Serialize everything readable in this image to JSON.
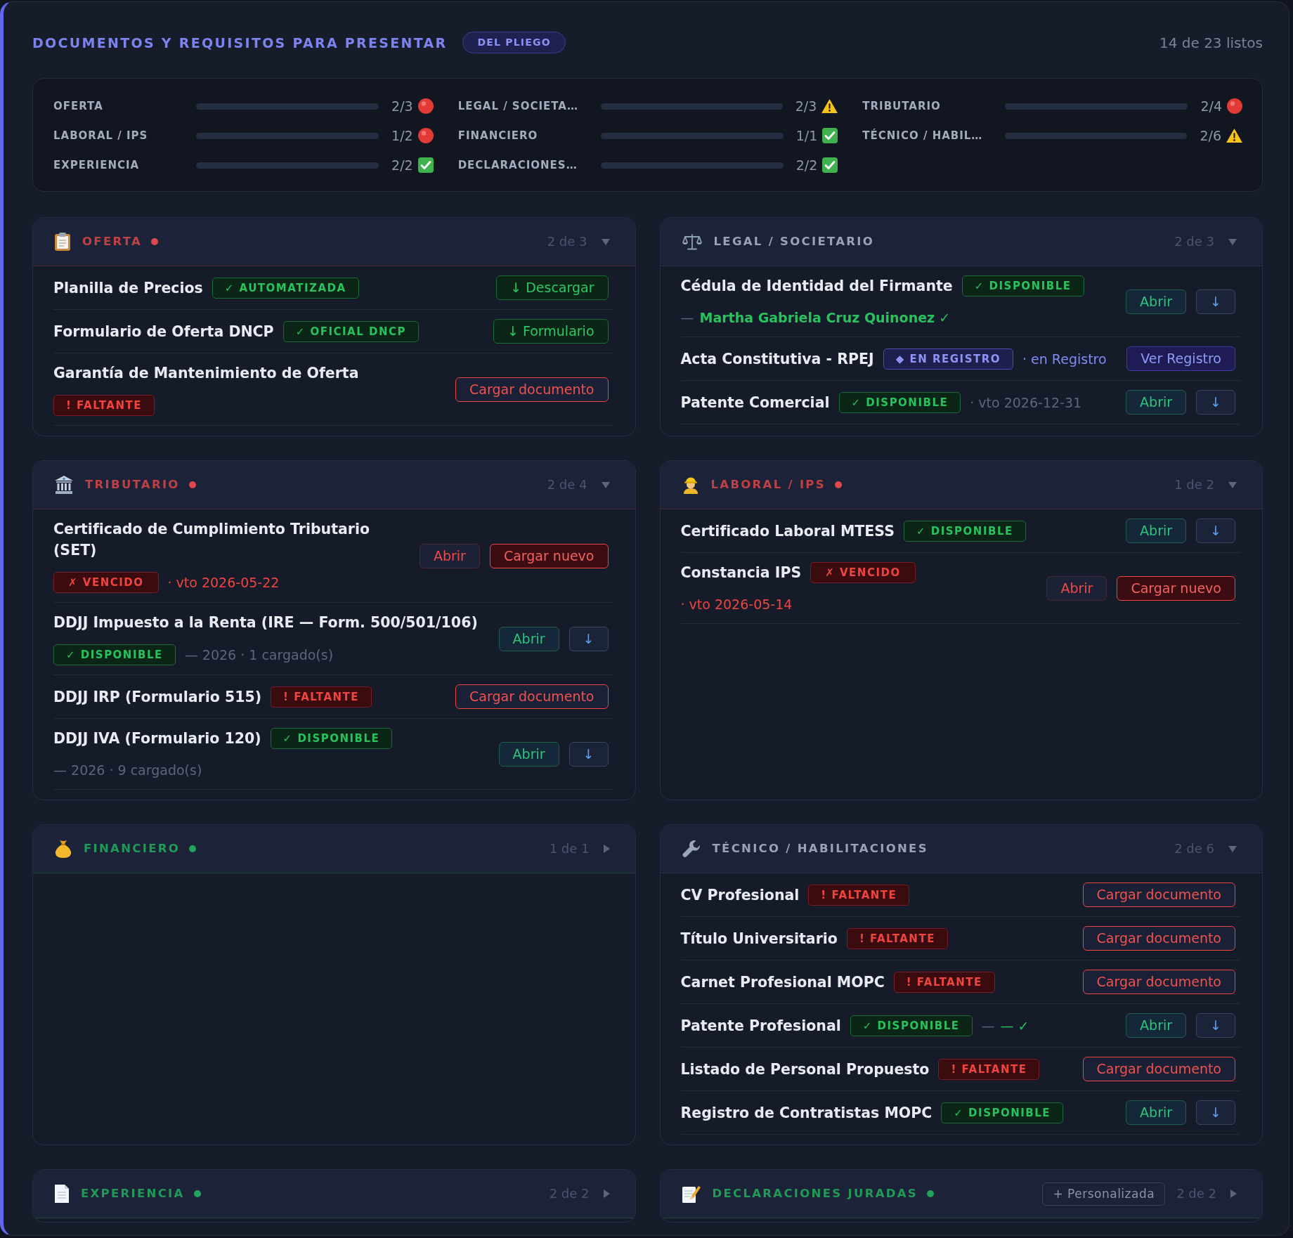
{
  "header": {
    "title": "DOCUMENTOS Y REQUISITOS PARA PRESENTAR",
    "source_badge": "DEL PLIEGO",
    "ready": "14 de 23 listos"
  },
  "summary": [
    {
      "label": "OFERTA",
      "level": 0,
      "count": "2/3",
      "kind": "missing"
    },
    {
      "label": "LEGAL / SOCIETA…",
      "level": 0,
      "count": "2/3",
      "kind": "partial"
    },
    {
      "label": "TRIBUTARIO",
      "level": 0,
      "count": "2/4",
      "kind": "missing"
    },
    {
      "label": "LABORAL / IPS",
      "level": 0,
      "count": "1/2",
      "kind": "missing"
    },
    {
      "label": "FINANCIERO",
      "level": 0,
      "count": "1/1",
      "kind": "complete"
    },
    {
      "label": "TÉCNICO / HABIL…",
      "level": 0,
      "count": "2/6",
      "kind": "partial"
    },
    {
      "label": "EXPERIENCIA",
      "level": 0,
      "count": "2/2",
      "kind": "complete"
    },
    {
      "label": "DECLARACIONES…",
      "level": 0,
      "count": "2/2",
      "kind": "complete"
    }
  ],
  "sections": [
    {
      "title": "OFERTA",
      "kind": "missing",
      "count": "2 de 3",
      "expanded": true,
      "items": [
        {
          "name": "Planilla de Precios",
          "badge": {
            "kind": "ok",
            "text": "✓ AUTOMATIZADA"
          },
          "actions": [
            {
              "kind": "download",
              "label": "↓ Descargar"
            }
          ]
        },
        {
          "name": "Formulario de Oferta DNCP",
          "badge": {
            "kind": "ok",
            "text": "✓ OFICIAL DNCP"
          },
          "actions": [
            {
              "kind": "download",
              "label": "↓ Formulario"
            }
          ]
        },
        {
          "name": "Garantía de Mantenimiento de Oferta",
          "badge": {
            "kind": "missing",
            "text": "! FALTANTE"
          },
          "actions": [
            {
              "kind": "upload",
              "label": "Cargar documento"
            }
          ]
        }
      ]
    },
    {
      "title": "LEGAL / SOCIETARIO",
      "kind": "partial",
      "count": "2 de 3",
      "expanded": true,
      "items": [
        {
          "name": "Cédula de Identidad del Firmante",
          "badge": {
            "kind": "ok",
            "text": "✓ DISPONIBLE"
          },
          "details": [
            {
              "kind": "muted",
              "text": "—"
            },
            {
              "kind": "valid",
              "text": "**Martha Gabriela Cruz Quinonez** ✓"
            }
          ],
          "actions": [
            {
              "kind": "open",
              "label": "Abrir"
            },
            {
              "kind": "save",
              "label": "↓"
            }
          ]
        },
        {
          "name": "Acta Constitutiva - RPEJ",
          "badge": {
            "kind": "registry",
            "text": "◆ EN REGISTRO"
          },
          "details": [
            {
              "kind": "registry",
              "text": "· en Registro"
            }
          ],
          "actions": [
            {
              "kind": "registry",
              "label": "Ver Registro"
            }
          ]
        },
        {
          "name": "Patente Comercial",
          "badge": {
            "kind": "ok",
            "text": "✓ DISPONIBLE"
          },
          "details": [
            {
              "kind": "muted",
              "text": "· vto 2026-12-31"
            }
          ],
          "actions": [
            {
              "kind": "open",
              "label": "Abrir"
            },
            {
              "kind": "save",
              "label": "↓"
            }
          ]
        }
      ]
    },
    {
      "title": "TRIBUTARIO",
      "kind": "missing",
      "count": "2 de 4",
      "expanded": true,
      "items": [
        {
          "name": "Certificado de Cumplimiento Tributario (SET)",
          "badge": {
            "kind": "expired",
            "text": "✗ VENCIDO"
          },
          "details": [
            {
              "kind": "expired",
              "text": "· vto 2026-05-22"
            }
          ],
          "actions": [
            {
              "kind": "open_expired",
              "label": "Abrir"
            },
            {
              "kind": "reupload",
              "label": "Cargar nuevo"
            }
          ]
        },
        {
          "name": "DDJJ Impuesto a la Renta (IRE — Form. 500/501/106)",
          "badge": {
            "kind": "ok",
            "text": "✓ DISPONIBLE"
          },
          "details": [
            {
              "kind": "muted",
              "text": "— 2026 · 1 cargado(s)"
            }
          ],
          "actions": [
            {
              "kind": "open",
              "label": "Abrir"
            },
            {
              "kind": "save",
              "label": "↓"
            }
          ]
        },
        {
          "name": "DDJJ IRP (Formulario 515)",
          "badge": {
            "kind": "missing",
            "text": "! FALTANTE"
          },
          "actions": [
            {
              "kind": "upload",
              "label": "Cargar documento"
            }
          ]
        },
        {
          "name": "DDJJ IVA (Formulario 120)",
          "badge": {
            "kind": "ok",
            "text": "✓ DISPONIBLE"
          },
          "details": [
            {
              "kind": "muted",
              "text": "— 2026 · 9 cargado(s)"
            }
          ],
          "actions": [
            {
              "kind": "open",
              "label": "Abrir"
            },
            {
              "kind": "save",
              "label": "↓"
            }
          ]
        }
      ]
    },
    {
      "title": "LABORAL / IPS",
      "kind": "missing",
      "count": "1 de 2",
      "expanded": true,
      "items": [
        {
          "name": "Certificado Laboral MTESS",
          "badge": {
            "kind": "ok",
            "text": "✓ DISPONIBLE"
          },
          "actions": [
            {
              "kind": "open",
              "label": "Abrir"
            },
            {
              "kind": "save",
              "label": "↓"
            }
          ]
        },
        {
          "name": "Constancia IPS",
          "badge": {
            "kind": "expired",
            "text": "✗ VENCIDO"
          },
          "details": [
            {
              "kind": "expired",
              "text": "· vto 2026-05-14"
            }
          ],
          "actions": [
            {
              "kind": "open_expired",
              "label": "Abrir"
            },
            {
              "kind": "reupload",
              "label": "Cargar nuevo"
            }
          ]
        }
      ]
    },
    {
      "title": "FINANCIERO",
      "kind": "complete",
      "count": "1 de 1",
      "expanded": false
    },
    {
      "title": "TÉCNICO / HABILITACIONES",
      "kind": "partial",
      "count": "2 de 6",
      "expanded": true,
      "items": [
        {
          "name": "CV Profesional",
          "badge": {
            "kind": "missing",
            "text": "! FALTANTE"
          },
          "actions": [
            {
              "kind": "upload",
              "label": "Cargar documento"
            }
          ]
        },
        {
          "name": "Título Universitario",
          "badge": {
            "kind": "missing",
            "text": "! FALTANTE"
          },
          "actions": [
            {
              "kind": "upload",
              "label": "Cargar documento"
            }
          ]
        },
        {
          "name": "Carnet Profesional MOPC",
          "badge": {
            "kind": "missing",
            "text": "! FALTANTE"
          },
          "actions": [
            {
              "kind": "upload",
              "label": "Cargar documento"
            }
          ]
        },
        {
          "name": "Patente Profesional",
          "badge": {
            "kind": "ok",
            "text": "✓ DISPONIBLE"
          },
          "details": [
            {
              "kind": "muted",
              "text": "—"
            },
            {
              "kind": "valid",
              "text": "— ✓"
            }
          ],
          "actions": [
            {
              "kind": "open",
              "label": "Abrir"
            },
            {
              "kind": "save",
              "label": "↓"
            }
          ]
        },
        {
          "name": "Listado de Personal Propuesto",
          "badge": {
            "kind": "missing",
            "text": "! FALTANTE"
          },
          "actions": [
            {
              "kind": "upload",
              "label": "Cargar documento"
            }
          ]
        },
        {
          "name": "Registro de Contratistas MOPC",
          "badge": {
            "kind": "ok",
            "text": "✓ DISPONIBLE"
          },
          "actions": [
            {
              "kind": "open",
              "label": "Abrir"
            },
            {
              "kind": "save",
              "label": "↓"
            }
          ]
        }
      ]
    },
    {
      "title": "EXPERIENCIA",
      "kind": "complete",
      "count": "2 de 2",
      "expanded": false
    },
    {
      "title": "DECLARACIONES JURADAS",
      "kind": "complete",
      "count": "2 de 2",
      "expanded": false,
      "action": {
        "label": "+ Personalizada"
      }
    }
  ]
}
